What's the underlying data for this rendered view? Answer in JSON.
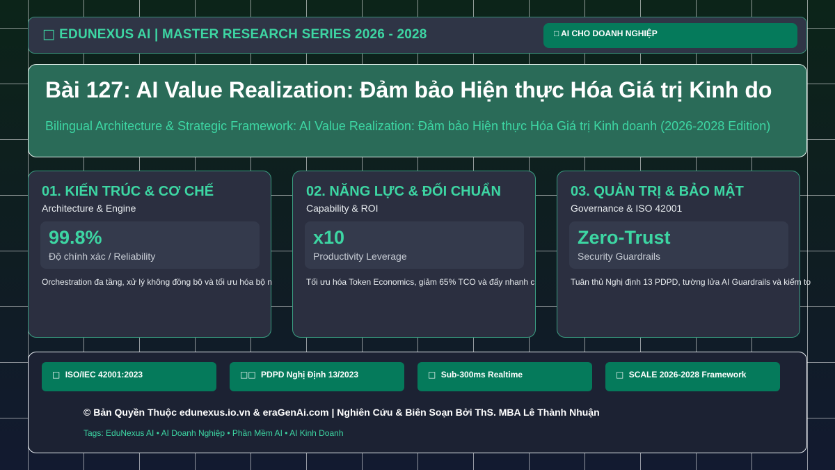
{
  "header": {
    "icon": "globe-icon",
    "brand_glyph": "□",
    "brand_text": "EDUNEXUS AI | MASTER RESEARCH SERIES 2026 - 2028",
    "badge": "□ AI CHO DOANH NGHIỆP"
  },
  "hero": {
    "title": "Bài 127: AI Value Realization: Đảm bảo Hiện thực Hóa Giá trị Kinh do",
    "subtitle": "Bilingual Architecture & Strategic Framework: AI Value Realization: Đảm bảo Hiện thực Hóa Giá trị Kinh doanh (2026-2028 Edition)"
  },
  "cards": [
    {
      "title": "01. KIẾN TRÚC & CƠ CHẾ",
      "subtitle": "Architecture & Engine",
      "metric_value": "99.8%",
      "metric_label": "Độ chính xác / Reliability",
      "description": "Orchestration đa tầng, xử lý không đồng bộ và tối ưu hóa bộ n"
    },
    {
      "title": "02. NĂNG LỰC & ĐỐI CHUẨN",
      "subtitle": "Capability & ROI",
      "metric_value": "x10",
      "metric_label": "Productivity Leverage",
      "description": "Tối ưu hóa Token Economics, giảm 65% TCO và đẩy nhanh c"
    },
    {
      "title": "03. QUẢN TRỊ & BẢO MẬT",
      "subtitle": "Governance & ISO 42001",
      "metric_value": "Zero-Trust",
      "metric_label": "Security Guardrails",
      "description": "Tuân thủ Nghị định 13 PDPD, tường lửa AI Guardrails và kiểm to"
    }
  ],
  "footer": {
    "tags": [
      {
        "glyph": "□",
        "text": "ISO/IEC 42001:2023"
      },
      {
        "glyph": "□□",
        "text": "PDPD Nghị Định 13/2023"
      },
      {
        "glyph": "□",
        "text": "Sub-300ms Realtime"
      },
      {
        "glyph": "□",
        "text": "SCALE 2026-2028 Framework"
      }
    ],
    "copyright": "© Bản Quyền Thuộc edunexus.io.vn & eraGenAi.com | Nghiên Cứu & Biên Soạn Bởi ThS. MBA Lê Thành Nhuận",
    "tags_line": "Tags: EduNexus AI • AI Doanh Nghiệp • Phần Mềm AI • AI Kinh Doanh"
  },
  "colors": {
    "accent": "#3dd6a3",
    "badge_green": "#057a5b",
    "card_bg": "#2b2f40",
    "hero_bg": "#2a6b58"
  }
}
